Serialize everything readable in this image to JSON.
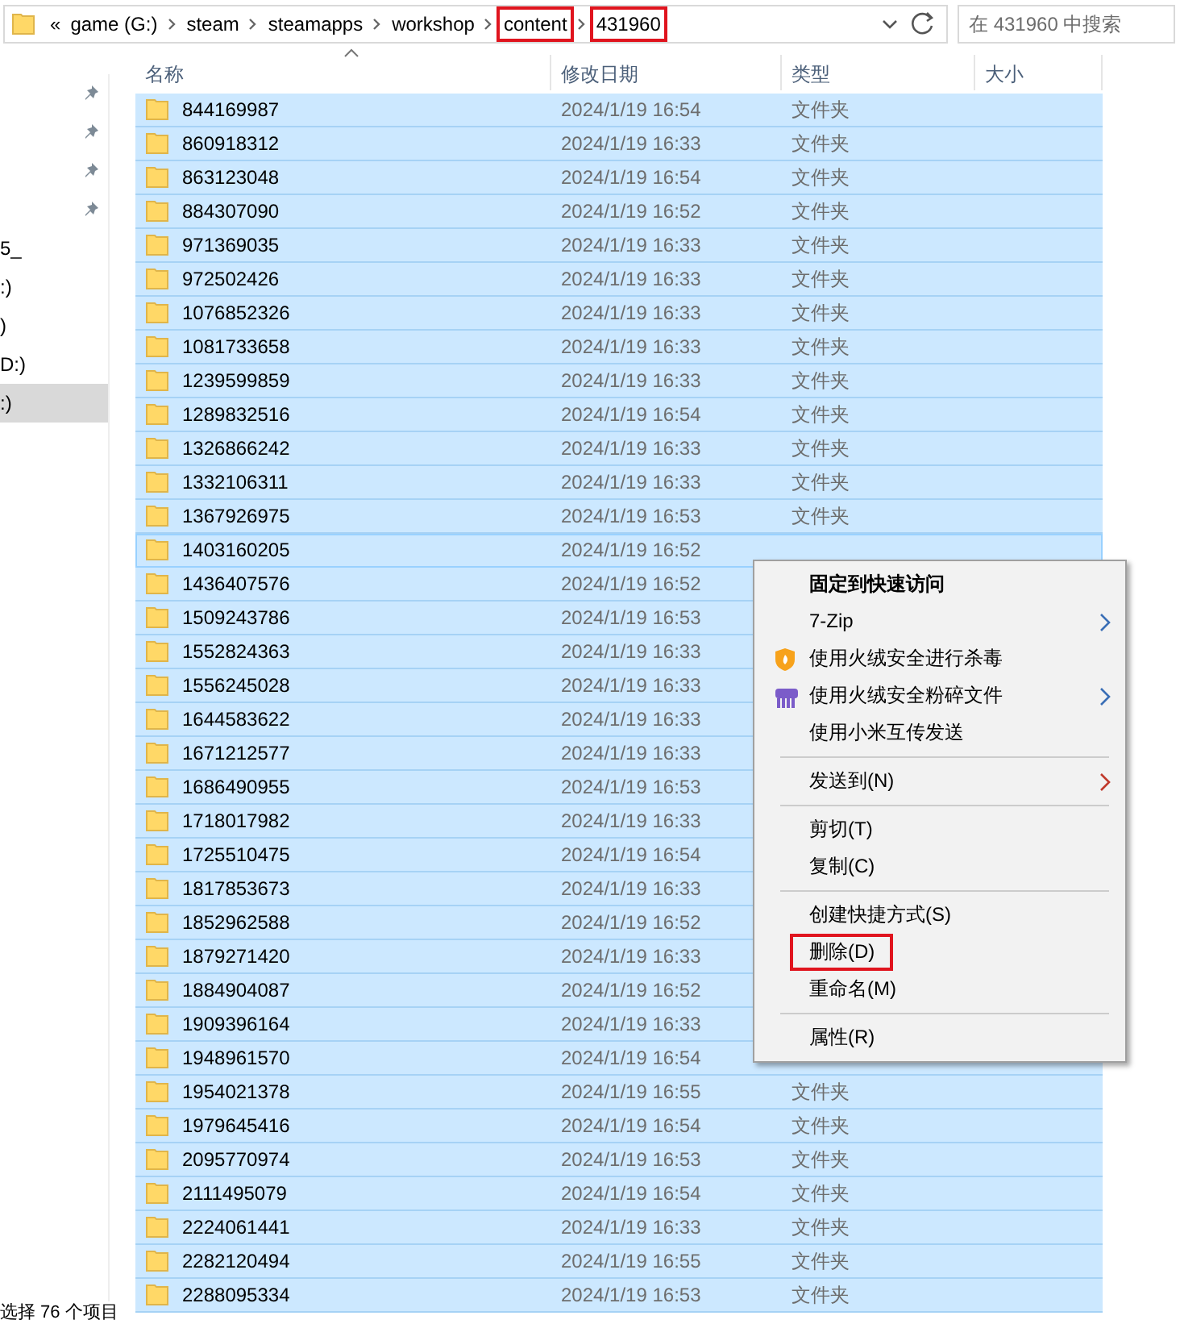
{
  "address_bar": {
    "overflow": "«",
    "crumbs": [
      {
        "label": "game (G:)",
        "highlighted": false
      },
      {
        "label": "steam",
        "highlighted": false
      },
      {
        "label": "steamapps",
        "highlighted": false
      },
      {
        "label": "workshop",
        "highlighted": false
      },
      {
        "label": "content",
        "highlighted": true
      },
      {
        "label": "431960",
        "highlighted": true
      }
    ],
    "search": {
      "placeholder": "在 431960 中搜索"
    }
  },
  "nav_pane": {
    "items": [
      {
        "pinned": true,
        "selected": false
      },
      {
        "pinned": true,
        "selected": false
      },
      {
        "pinned": true,
        "selected": false
      },
      {
        "pinned": true,
        "selected": false
      },
      {
        "label": "5_",
        "pinned": false,
        "selected": false
      },
      {
        "label": ":)",
        "pinned": false,
        "selected": false
      },
      {
        "label": ")",
        "pinned": false,
        "selected": false
      },
      {
        "label": "D:)",
        "pinned": false,
        "selected": false
      },
      {
        "label": ":)",
        "pinned": false,
        "selected": true
      }
    ]
  },
  "columns": [
    {
      "label": "名称",
      "sorted": true
    },
    {
      "label": "修改日期",
      "sorted": false
    },
    {
      "label": "类型",
      "sorted": false
    },
    {
      "label": "大小",
      "sorted": false
    }
  ],
  "rows": [
    {
      "name": "844169987",
      "date": "2024/1/19 16:54",
      "type": "文件夹",
      "selected": true,
      "focused": false
    },
    {
      "name": "860918312",
      "date": "2024/1/19 16:33",
      "type": "文件夹",
      "selected": true,
      "focused": false
    },
    {
      "name": "863123048",
      "date": "2024/1/19 16:54",
      "type": "文件夹",
      "selected": true,
      "focused": false
    },
    {
      "name": "884307090",
      "date": "2024/1/19 16:52",
      "type": "文件夹",
      "selected": true,
      "focused": false
    },
    {
      "name": "971369035",
      "date": "2024/1/19 16:33",
      "type": "文件夹",
      "selected": true,
      "focused": false
    },
    {
      "name": "972502426",
      "date": "2024/1/19 16:33",
      "type": "文件夹",
      "selected": true,
      "focused": false
    },
    {
      "name": "1076852326",
      "date": "2024/1/19 16:33",
      "type": "文件夹",
      "selected": true,
      "focused": false
    },
    {
      "name": "1081733658",
      "date": "2024/1/19 16:33",
      "type": "文件夹",
      "selected": true,
      "focused": false
    },
    {
      "name": "1239599859",
      "date": "2024/1/19 16:33",
      "type": "文件夹",
      "selected": true,
      "focused": false
    },
    {
      "name": "1289832516",
      "date": "2024/1/19 16:54",
      "type": "文件夹",
      "selected": true,
      "focused": false
    },
    {
      "name": "1326866242",
      "date": "2024/1/19 16:33",
      "type": "文件夹",
      "selected": true,
      "focused": false
    },
    {
      "name": "1332106311",
      "date": "2024/1/19 16:33",
      "type": "文件夹",
      "selected": true,
      "focused": false
    },
    {
      "name": "1367926975",
      "date": "2024/1/19 16:53",
      "type": "文件夹",
      "selected": true,
      "focused": false
    },
    {
      "name": "1403160205",
      "date": "2024/1/19 16:52",
      "selected": true,
      "focused": true
    },
    {
      "name": "1436407576",
      "date": "2024/1/19 16:52",
      "selected": true,
      "focused": false
    },
    {
      "name": "1509243786",
      "date": "2024/1/19 16:53",
      "selected": true,
      "focused": false
    },
    {
      "name": "1552824363",
      "date": "2024/1/19 16:33",
      "selected": true,
      "focused": false
    },
    {
      "name": "1556245028",
      "date": "2024/1/19 16:33",
      "selected": true,
      "focused": false
    },
    {
      "name": "1644583622",
      "date": "2024/1/19 16:33",
      "selected": true,
      "focused": false
    },
    {
      "name": "1671212577",
      "date": "2024/1/19 16:33",
      "selected": true,
      "focused": false
    },
    {
      "name": "1686490955",
      "date": "2024/1/19 16:53",
      "selected": true,
      "focused": false
    },
    {
      "name": "1718017982",
      "date": "2024/1/19 16:33",
      "selected": true,
      "focused": false
    },
    {
      "name": "1725510475",
      "date": "2024/1/19 16:54",
      "selected": true,
      "focused": false
    },
    {
      "name": "1817853673",
      "date": "2024/1/19 16:33",
      "selected": true,
      "focused": false
    },
    {
      "name": "1852962588",
      "date": "2024/1/19 16:52",
      "selected": true,
      "focused": false
    },
    {
      "name": "1879271420",
      "date": "2024/1/19 16:33",
      "selected": true,
      "focused": false
    },
    {
      "name": "1884904087",
      "date": "2024/1/19 16:52",
      "selected": true,
      "focused": false
    },
    {
      "name": "1909396164",
      "date": "2024/1/19 16:33",
      "selected": true,
      "focused": false
    },
    {
      "name": "1948961570",
      "date": "2024/1/19 16:54",
      "selected": true,
      "focused": false
    },
    {
      "name": "1954021378",
      "date": "2024/1/19 16:55",
      "type": "文件夹",
      "selected": true,
      "focused": false
    },
    {
      "name": "1979645416",
      "date": "2024/1/19 16:54",
      "type": "文件夹",
      "selected": true,
      "focused": false
    },
    {
      "name": "2095770974",
      "date": "2024/1/19 16:53",
      "type": "文件夹",
      "selected": true,
      "focused": false
    },
    {
      "name": "2111495079",
      "date": "2024/1/19 16:54",
      "type": "文件夹",
      "selected": true,
      "focused": false
    },
    {
      "name": "2224061441",
      "date": "2024/1/19 16:33",
      "type": "文件夹",
      "selected": true,
      "focused": false
    },
    {
      "name": "2282120494",
      "date": "2024/1/19 16:55",
      "type": "文件夹",
      "selected": true,
      "focused": false
    },
    {
      "name": "2288095334",
      "date": "2024/1/19 16:53",
      "type": "文件夹",
      "selected": true,
      "focused": false
    }
  ],
  "status_bar": "选择 76 个项目",
  "context_menu": {
    "items": [
      {
        "kind": "item",
        "label": "固定到快速访问",
        "bold": true,
        "submenu": false,
        "highlighted": false
      },
      {
        "kind": "item",
        "label": "7-Zip",
        "bold": false,
        "submenu": true,
        "highlighted": false
      },
      {
        "kind": "antivirus",
        "label": "使用火绒安全进行杀毒",
        "bold": false,
        "submenu": false,
        "highlighted": false
      },
      {
        "kind": "shred",
        "label": "使用火绒安全粉碎文件",
        "bold": false,
        "submenu": true,
        "highlighted": false
      },
      {
        "kind": "item",
        "label": "使用小米互传发送",
        "bold": false,
        "submenu": false,
        "highlighted": false
      },
      {
        "kind": "separator"
      },
      {
        "kind": "item",
        "label": "发送到(N)",
        "bold": false,
        "submenu": true,
        "highlighted": false
      },
      {
        "kind": "separator"
      },
      {
        "kind": "item",
        "label": "剪切(T)",
        "bold": false,
        "submenu": false,
        "highlighted": false
      },
      {
        "kind": "item",
        "label": "复制(C)",
        "bold": false,
        "submenu": false,
        "highlighted": false
      },
      {
        "kind": "separator"
      },
      {
        "kind": "item",
        "label": "创建快捷方式(S)",
        "bold": false,
        "submenu": false,
        "highlighted": false
      },
      {
        "kind": "item",
        "label": "删除(D)",
        "bold": false,
        "submenu": false,
        "highlighted": true
      },
      {
        "kind": "item",
        "label": "重命名(M)",
        "bold": false,
        "submenu": false,
        "highlighted": false
      },
      {
        "kind": "separator"
      },
      {
        "kind": "item",
        "label": "属性(R)",
        "bold": false,
        "submenu": false,
        "highlighted": false
      }
    ]
  }
}
